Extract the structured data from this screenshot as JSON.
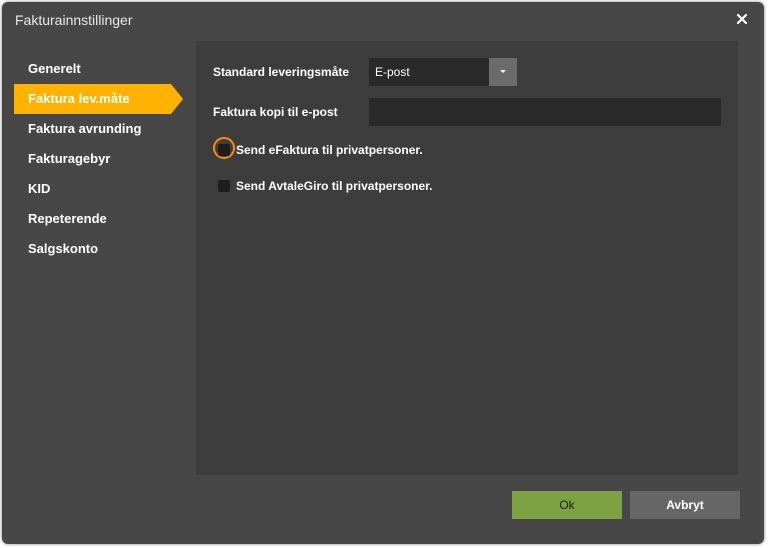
{
  "dialog": {
    "title": "Fakturainnstillinger",
    "close_icon": "close-icon"
  },
  "sidebar": {
    "items": [
      {
        "label": "Generelt",
        "active": false
      },
      {
        "label": "Faktura lev.måte",
        "active": true
      },
      {
        "label": "Faktura avrunding",
        "active": false
      },
      {
        "label": "Fakturagebyr",
        "active": false
      },
      {
        "label": "KID",
        "active": false
      },
      {
        "label": "Repeterende",
        "active": false
      },
      {
        "label": "Salgskonto",
        "active": false
      }
    ]
  },
  "form": {
    "delivery_label": "Standard leveringsmåte",
    "delivery_value": "E-post",
    "copy_email_label": "Faktura kopi til e-post",
    "copy_email_value": "",
    "efaktura_label": "Send eFaktura til privatpersoner.",
    "efaktura_checked": false,
    "avtalegiro_label": "Send AvtaleGiro til privatpersoner.",
    "avtalegiro_checked": false
  },
  "buttons": {
    "ok_label": "Ok",
    "cancel_label": "Avbryt"
  },
  "colors": {
    "accent": "#ffb300",
    "ok_button": "#7ca243",
    "focus_ring": "#ff8c00",
    "dialog_bg": "#474747",
    "panel_bg": "#3d3d3d"
  }
}
